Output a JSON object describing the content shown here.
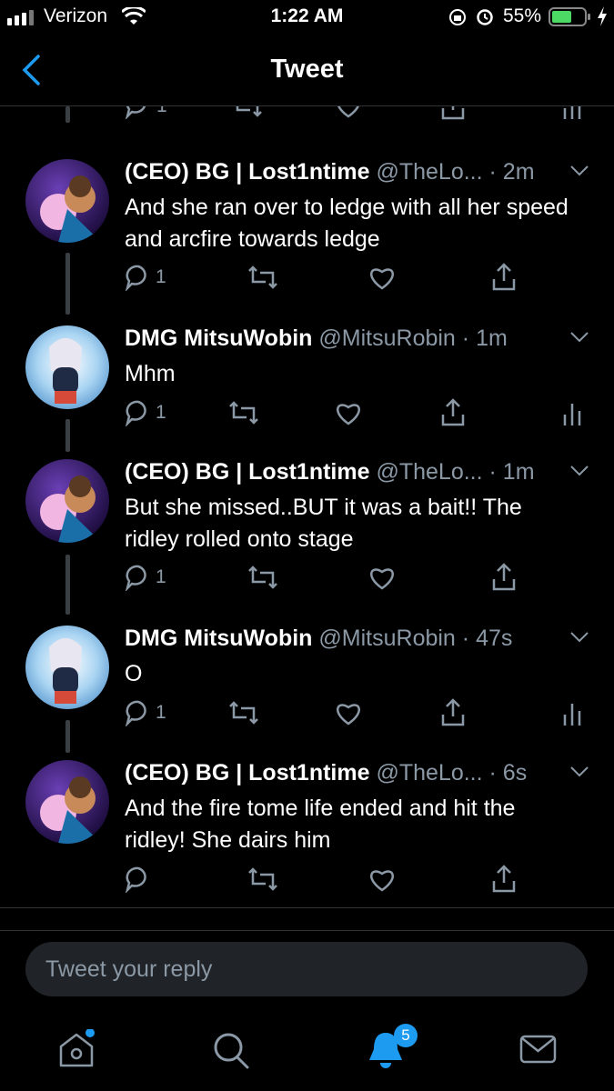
{
  "status_bar": {
    "carrier": "Verizon",
    "time": "1:22 AM",
    "battery": "55%"
  },
  "nav": {
    "title": "Tweet"
  },
  "colors": {
    "accent": "#1d9bf0",
    "muted": "#8b98a5",
    "background": "#000000"
  },
  "top_partial": {
    "reply_count": "1"
  },
  "tweets": [
    {
      "name": "(CEO) BG | Lost1ntime",
      "handle": "@TheLo...",
      "time": "2m",
      "text": "And she ran over to ledge with all her speed and arcfire towards ledge",
      "reply_count": "1",
      "analytics": false
    },
    {
      "name": "DMG MitsuWobin",
      "handle": "@MitsuRobin",
      "time": "1m",
      "text": "Mhm",
      "reply_count": "1",
      "analytics": true
    },
    {
      "name": "(CEO) BG | Lost1ntime",
      "handle": "@TheLo...",
      "time": "1m",
      "text": "But she missed..BUT it was a bait!! The ridley rolled onto stage",
      "reply_count": "1",
      "analytics": false
    },
    {
      "name": "DMG MitsuWobin",
      "handle": "@MitsuRobin",
      "time": "47s",
      "text": "O",
      "reply_count": "1",
      "analytics": true
    },
    {
      "name": "(CEO) BG | Lost1ntime",
      "handle": "@TheLo...",
      "time": "6s",
      "text": "And the fire tome life ended and hit the ridley! She dairs him",
      "reply_count": "",
      "analytics": false
    }
  ],
  "reply": {
    "placeholder": "Tweet your reply"
  },
  "tabbar": {
    "notifications_badge": "5",
    "icons": [
      "home-icon",
      "search-icon",
      "notifications-icon",
      "messages-icon"
    ]
  }
}
